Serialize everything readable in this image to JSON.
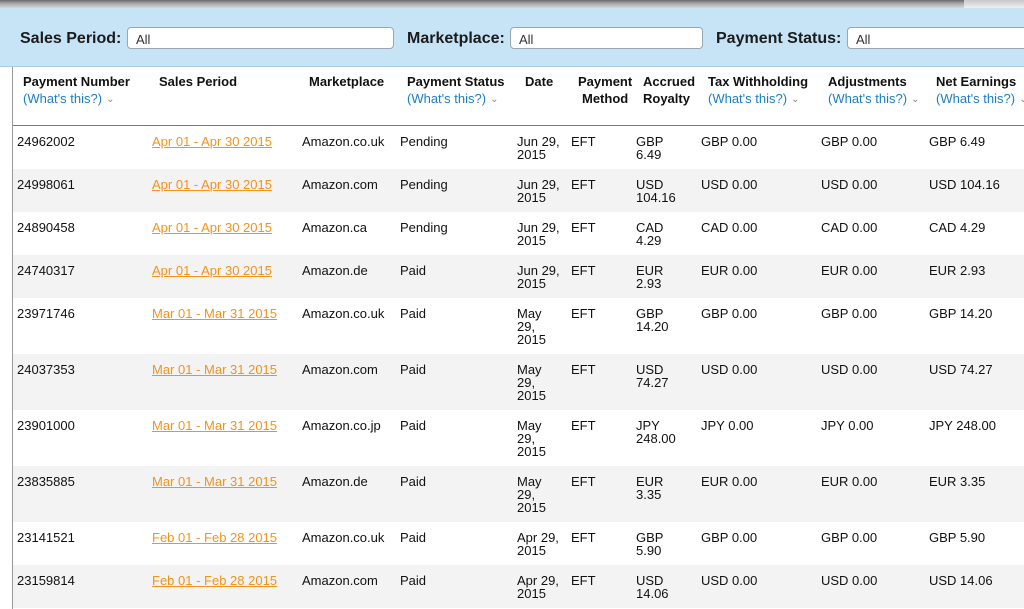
{
  "filters": {
    "sales_period_label": "Sales Period:",
    "sales_period_value": "All",
    "marketplace_label": "Marketplace:",
    "marketplace_value": "All",
    "payment_status_label": "Payment Status:",
    "payment_status_value": "All"
  },
  "columns": {
    "payment_number": "Payment Number",
    "sales_period": "Sales Period",
    "marketplace": "Marketplace",
    "payment_status": "Payment Status",
    "date": "Date",
    "payment_method_1": "Payment",
    "payment_method_2": "Method",
    "accrued_royalty_1": "Accrued",
    "accrued_royalty_2": "Royalty",
    "tax_withholding": "Tax Withholding",
    "adjustments": "Adjustments",
    "net_earnings": "Net Earnings",
    "whats_this": "(What's this?)"
  },
  "rows": [
    {
      "payment_number": "24962002",
      "sales_period": "Apr 01 - Apr 30 2015",
      "marketplace": "Amazon.co.uk",
      "status": "Pending",
      "date_1": "Jun 29,",
      "date_2": "2015",
      "date_3": "",
      "method": "EFT",
      "royalty_1": "GBP",
      "royalty_2": "6.49",
      "tax": "GBP 0.00",
      "adjustments": "GBP 0.00",
      "net": "GBP 6.49"
    },
    {
      "payment_number": "24998061",
      "sales_period": "Apr 01 - Apr 30 2015",
      "marketplace": "Amazon.com",
      "status": "Pending",
      "date_1": "Jun 29,",
      "date_2": "2015",
      "date_3": "",
      "method": "EFT",
      "royalty_1": "USD",
      "royalty_2": "104.16",
      "tax": "USD 0.00",
      "adjustments": "USD 0.00",
      "net": "USD 104.16"
    },
    {
      "payment_number": "24890458",
      "sales_period": "Apr 01 - Apr 30 2015",
      "marketplace": "Amazon.ca",
      "status": "Pending",
      "date_1": "Jun 29,",
      "date_2": "2015",
      "date_3": "",
      "method": "EFT",
      "royalty_1": "CAD",
      "royalty_2": "4.29",
      "tax": "CAD 0.00",
      "adjustments": "CAD 0.00",
      "net": "CAD 4.29"
    },
    {
      "payment_number": "24740317",
      "sales_period": "Apr 01 - Apr 30 2015",
      "marketplace": "Amazon.de",
      "status": "Paid",
      "date_1": "Jun 29,",
      "date_2": "2015",
      "date_3": "",
      "method": "EFT",
      "royalty_1": "EUR",
      "royalty_2": "2.93",
      "tax": "EUR 0.00",
      "adjustments": "EUR 0.00",
      "net": "EUR 2.93"
    },
    {
      "payment_number": "23971746",
      "sales_period": "Mar 01 - Mar 31 2015",
      "marketplace": "Amazon.co.uk",
      "status": "Paid",
      "date_1": "May",
      "date_2": "29,",
      "date_3": "2015",
      "method": "EFT",
      "royalty_1": "GBP",
      "royalty_2": "14.20",
      "tax": "GBP 0.00",
      "adjustments": "GBP 0.00",
      "net": "GBP 14.20"
    },
    {
      "payment_number": "24037353",
      "sales_period": "Mar 01 - Mar 31 2015",
      "marketplace": "Amazon.com",
      "status": "Paid",
      "date_1": "May",
      "date_2": "29,",
      "date_3": "2015",
      "method": "EFT",
      "royalty_1": "USD",
      "royalty_2": "74.27",
      "tax": "USD 0.00",
      "adjustments": "USD 0.00",
      "net": "USD 74.27"
    },
    {
      "payment_number": "23901000",
      "sales_period": "Mar 01 - Mar 31 2015",
      "marketplace": "Amazon.co.jp",
      "status": "Paid",
      "date_1": "May",
      "date_2": "29,",
      "date_3": "2015",
      "method": "EFT",
      "royalty_1": "JPY",
      "royalty_2": "248.00",
      "tax": "JPY 0.00",
      "adjustments": "JPY 0.00",
      "net": "JPY 248.00"
    },
    {
      "payment_number": "23835885",
      "sales_period": "Mar 01 - Mar 31 2015",
      "marketplace": "Amazon.de",
      "status": "Paid",
      "date_1": "May",
      "date_2": "29,",
      "date_3": "2015",
      "method": "EFT",
      "royalty_1": "EUR",
      "royalty_2": "3.35",
      "tax": "EUR 0.00",
      "adjustments": "EUR 0.00",
      "net": "EUR 3.35"
    },
    {
      "payment_number": "23141521",
      "sales_period": "Feb 01 - Feb 28 2015",
      "marketplace": "Amazon.co.uk",
      "status": "Paid",
      "date_1": "Apr 29,",
      "date_2": "2015",
      "date_3": "",
      "method": "EFT",
      "royalty_1": "GBP",
      "royalty_2": "5.90",
      "tax": "GBP 0.00",
      "adjustments": "GBP 0.00",
      "net": "GBP 5.90"
    },
    {
      "payment_number": "23159814",
      "sales_period": "Feb 01 - Feb 28 2015",
      "marketplace": "Amazon.com",
      "status": "Paid",
      "date_1": "Apr 29,",
      "date_2": "2015",
      "date_3": "",
      "method": "EFT",
      "royalty_1": "USD",
      "royalty_2": "14.06",
      "tax": "USD 0.00",
      "adjustments": "USD 0.00",
      "net": "USD 14.06"
    }
  ]
}
